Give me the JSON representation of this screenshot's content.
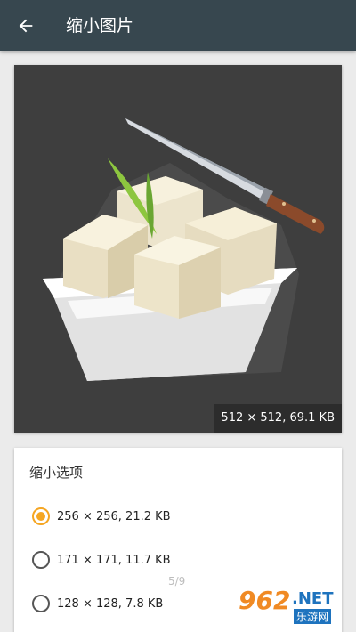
{
  "app_bar": {
    "title": "缩小图片",
    "back_icon": "arrow-back-icon",
    "color": "#37474f"
  },
  "preview": {
    "size_caption": "512 × 512,  69.1 KB",
    "image_subject": "tofu-bowl-with-knife"
  },
  "options": {
    "title": "缩小选项",
    "items": [
      {
        "label": "256 × 256,  21.2 KB",
        "checked": true
      },
      {
        "label": "171 × 171,  11.7 KB",
        "checked": false
      },
      {
        "label": "128 × 128,  7.8 KB",
        "checked": false
      }
    ]
  },
  "page_indicator": "5/9",
  "watermark": {
    "number": "962",
    "suffix": ".NET",
    "text": "乐游网"
  },
  "colors": {
    "accent": "#f5a623",
    "background": "#ebebeb"
  }
}
